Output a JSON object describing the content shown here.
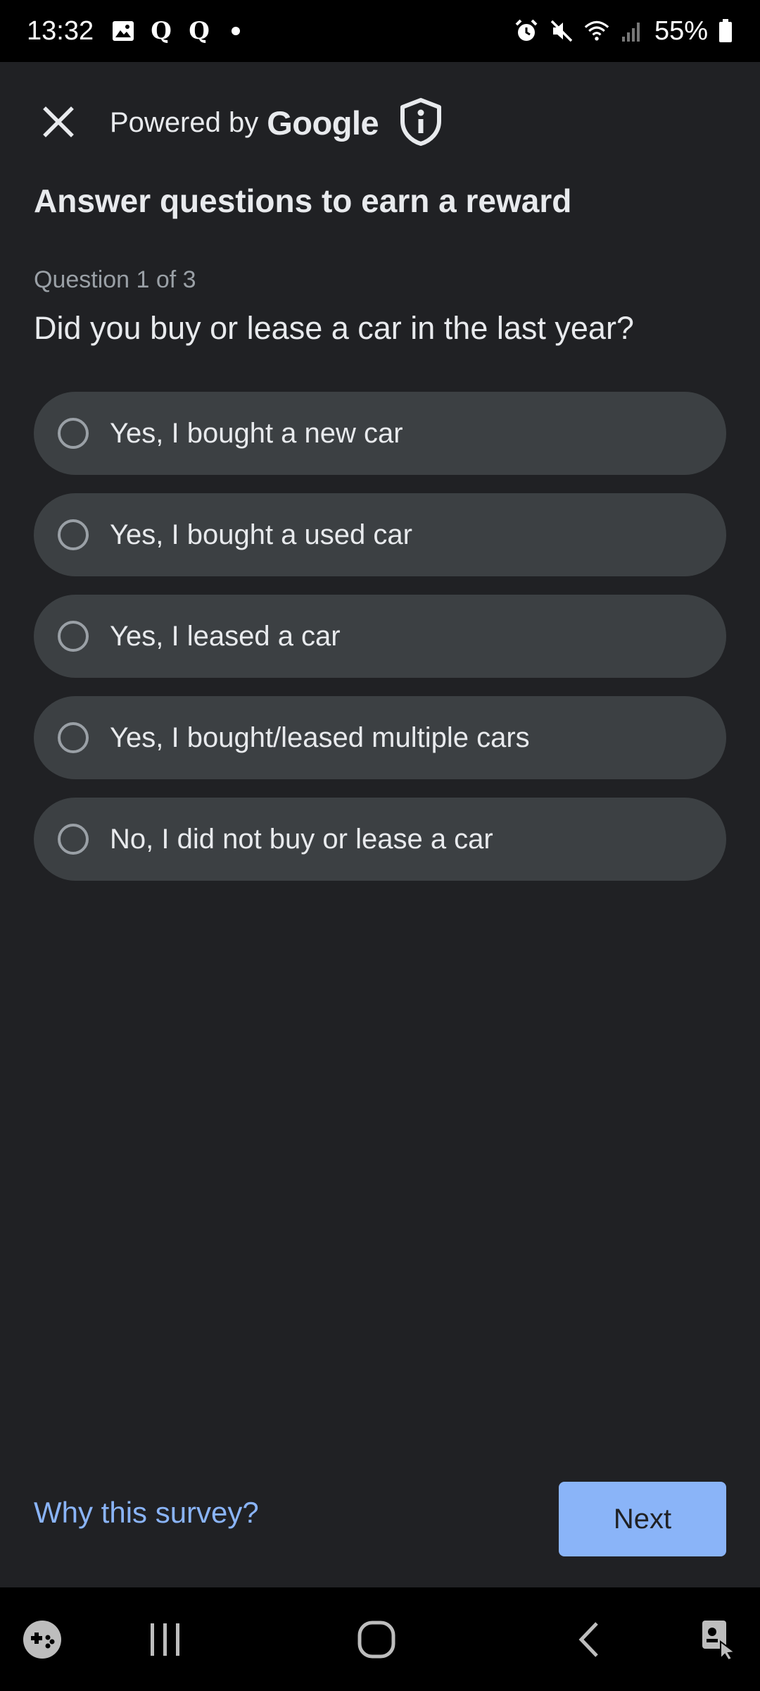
{
  "status_bar": {
    "time": "13:32",
    "battery_percent": "55%",
    "left_icons": [
      "gallery-icon",
      "q-app-icon",
      "q-app-icon",
      "notification-dot-icon"
    ],
    "right_icons": [
      "alarm-icon",
      "mute-icon",
      "wifi-icon",
      "signal-icon",
      "battery-icon"
    ],
    "q_glyph": "Q"
  },
  "header": {
    "powered_prefix": "Powered by",
    "brand": "Google"
  },
  "survey": {
    "title": "Answer questions to earn a reward",
    "counter": "Question 1 of 3",
    "question": "Did you buy or lease a car in the last year?",
    "options": [
      {
        "label": "Yes, I bought a new car",
        "selected": false
      },
      {
        "label": "Yes, I bought a used car",
        "selected": false
      },
      {
        "label": "Yes, I leased a car",
        "selected": false
      },
      {
        "label": "Yes, I bought/leased multiple cars",
        "selected": false
      },
      {
        "label": "No, I did not buy or lease a car",
        "selected": false
      }
    ]
  },
  "footer": {
    "why_link": "Why this survey?",
    "next_label": "Next"
  },
  "nav_bar": {
    "items": [
      "game-launcher-icon",
      "recent-apps-icon",
      "home-icon",
      "back-icon",
      "assistant-icon"
    ]
  },
  "colors": {
    "background": "#202124",
    "option_bg": "#3c4043",
    "accent": "#8ab4f8",
    "text_primary": "#e8eaed",
    "text_secondary": "#9aa0a6"
  }
}
